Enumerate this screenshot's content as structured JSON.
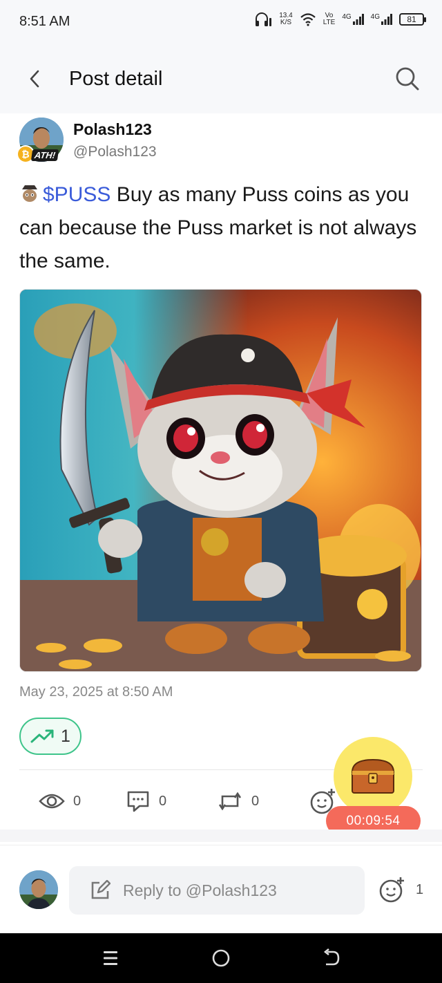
{
  "status_bar": {
    "time": "8:51 AM",
    "speed_value": "13.4",
    "speed_unit": "K/S",
    "net_top": "Vo",
    "net_bottom": "LTE",
    "signal1": "4G",
    "signal2": "4G",
    "battery": "81"
  },
  "header": {
    "title": "Post detail",
    "back_icon": "chevron-left-icon",
    "search_icon": "search-icon"
  },
  "author": {
    "name": "Polash123",
    "handle": "@Polash123",
    "badge_text": "ATH!",
    "coin_symbol": "₿"
  },
  "post": {
    "ticker": "$PUSS",
    "text": " Buy as many Puss coins as you can because the Puss market is not always the same.",
    "date": "May 23, 2025 at 8:50 AM"
  },
  "trend": {
    "count": "1",
    "icon": "trending-up-icon",
    "color": "#3ec48a"
  },
  "actions": {
    "views": "0",
    "comments": "0",
    "reposts": "0"
  },
  "floating": {
    "timer": "00:09:54",
    "chest_icon": "treasure-chest-icon"
  },
  "reply": {
    "placeholder": "Reply to @Polash123",
    "reaction_count": "1"
  },
  "colors": {
    "ticker": "#3a5bd9",
    "timer_bg": "#f46a5a",
    "fab_bg": "#fbe86a"
  }
}
